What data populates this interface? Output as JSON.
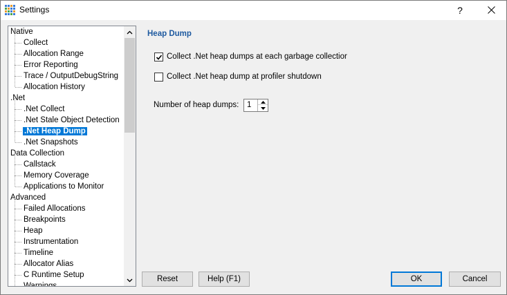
{
  "window": {
    "title": "Settings",
    "help_label": "?"
  },
  "tree": {
    "items": [
      {
        "label": "Native",
        "level": 0
      },
      {
        "label": "Collect",
        "level": 1
      },
      {
        "label": "Allocation Range",
        "level": 1
      },
      {
        "label": "Error Reporting",
        "level": 1
      },
      {
        "label": "Trace / OutputDebugString",
        "level": 1
      },
      {
        "label": "Allocation History",
        "level": 1
      },
      {
        "label": ".Net",
        "level": 0
      },
      {
        "label": ".Net Collect",
        "level": 1
      },
      {
        "label": ".Net Stale Object Detection",
        "level": 1
      },
      {
        "label": ".Net Heap Dump",
        "level": 1,
        "selected": true
      },
      {
        "label": ".Net Snapshots",
        "level": 1
      },
      {
        "label": "Data Collection",
        "level": 0
      },
      {
        "label": "Callstack",
        "level": 1
      },
      {
        "label": "Memory Coverage",
        "level": 1
      },
      {
        "label": "Applications to Monitor",
        "level": 1
      },
      {
        "label": "Advanced",
        "level": 0
      },
      {
        "label": "Failed Allocations",
        "level": 1
      },
      {
        "label": "Breakpoints",
        "level": 1
      },
      {
        "label": "Heap",
        "level": 1
      },
      {
        "label": "Instrumentation",
        "level": 1
      },
      {
        "label": "Timeline",
        "level": 1
      },
      {
        "label": "Allocator Alias",
        "level": 1
      },
      {
        "label": "C Runtime Setup",
        "level": 1
      },
      {
        "label": "Warnings",
        "level": 1
      }
    ]
  },
  "panel": {
    "title": "Heap Dump",
    "collect_each_gc": {
      "label": "Collect .Net heap dumps at each garbage collectior",
      "checked": true
    },
    "collect_at_shutdown": {
      "label": "Collect .Net heap dump at profiler shutdown",
      "checked": false
    },
    "num_dumps_label": "Number of heap dumps:",
    "num_dumps_value": "1"
  },
  "buttons": {
    "reset": "Reset",
    "help": "Help (F1)",
    "ok": "OK",
    "cancel": "Cancel"
  },
  "colors": {
    "selection": "#0078d7",
    "section_title": "#1e5aa0"
  }
}
